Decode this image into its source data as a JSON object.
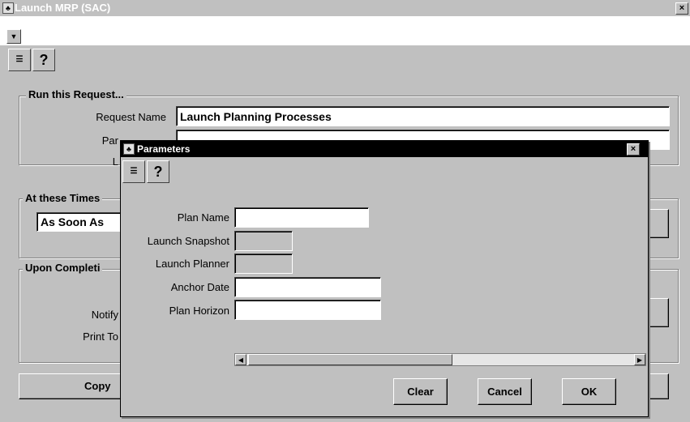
{
  "window": {
    "title": "Launch MRP (SAC)",
    "close_glyph": "×"
  },
  "toolbar": {
    "help_glyph": "?",
    "menu_icon": "list-icon",
    "help_icon": "help-icon"
  },
  "run_group": {
    "title": "Run this Request...",
    "request_name_label": "Request Name",
    "request_name_value": "Launch Planning Processes",
    "parameters_label_partial": "Par",
    "language_label_partial": "L"
  },
  "times_group": {
    "title": "At these Times",
    "schedule_value": "As Soon As"
  },
  "completion_group": {
    "title": "Upon Completi",
    "notify_label_partial": "Notify",
    "print_to_label_partial": "Print To"
  },
  "copy_button_partial": "Copy",
  "dialog": {
    "title": "Parameters",
    "close_glyph": "×",
    "help_glyph": "?",
    "fields": {
      "plan_name": {
        "label": "Plan Name",
        "value": ""
      },
      "launch_snapshot": {
        "label": "Launch Snapshot",
        "value": ""
      },
      "launch_planner": {
        "label": "Launch Planner",
        "value": ""
      },
      "anchor_date": {
        "label": "Anchor Date",
        "value": ""
      },
      "plan_horizon": {
        "label": "Plan Horizon",
        "value": ""
      }
    },
    "buttons": {
      "clear": "Clear",
      "cancel": "Cancel",
      "ok": "OK"
    }
  }
}
